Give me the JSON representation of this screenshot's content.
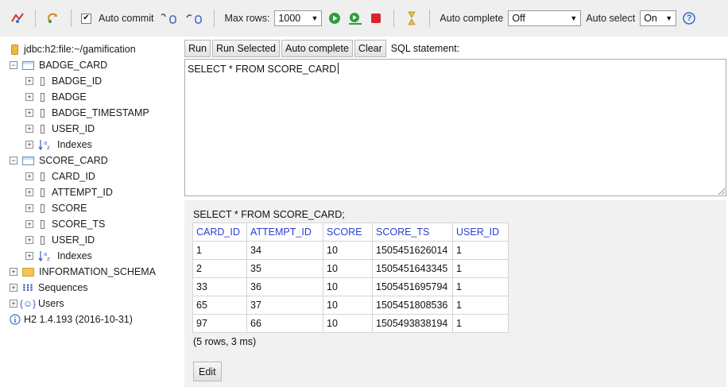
{
  "toolbar": {
    "auto_commit_label": "Auto commit",
    "auto_commit_checked": true,
    "max_rows_label": "Max rows:",
    "max_rows_value": "1000",
    "auto_complete_label": "Auto complete",
    "auto_complete_value": "Off",
    "auto_select_label": "Auto select",
    "auto_select_value": "On",
    "help_glyph": "?"
  },
  "tree": {
    "connection": "jdbc:h2:file:~/gamification",
    "tables": [
      {
        "name": "BADGE_CARD",
        "columns": [
          "BADGE_ID",
          "BADGE",
          "BADGE_TIMESTAMP",
          "USER_ID"
        ],
        "indexes_label": "Indexes"
      },
      {
        "name": "SCORE_CARD",
        "columns": [
          "CARD_ID",
          "ATTEMPT_ID",
          "SCORE",
          "SCORE_TS",
          "USER_ID"
        ],
        "indexes_label": "Indexes"
      }
    ],
    "schema_label": "INFORMATION_SCHEMA",
    "sequences_label": "Sequences",
    "users_label": "Users",
    "version": "H2 1.4.193 (2016-10-31)"
  },
  "sql_buttons": {
    "run": "Run",
    "run_selected": "Run Selected",
    "auto_complete": "Auto complete",
    "clear": "Clear",
    "statement_label": "SQL statement:"
  },
  "editor": {
    "text": "SELECT * FROM SCORE_CARD"
  },
  "results": {
    "query": "SELECT * FROM SCORE_CARD;",
    "columns": [
      "CARD_ID",
      "ATTEMPT_ID",
      "SCORE",
      "SCORE_TS",
      "USER_ID"
    ],
    "rows": [
      [
        "1",
        "34",
        "10",
        "1505451626014",
        "1"
      ],
      [
        "2",
        "35",
        "10",
        "1505451643345",
        "1"
      ],
      [
        "33",
        "36",
        "10",
        "1505451695794",
        "1"
      ],
      [
        "65",
        "37",
        "10",
        "1505451808536",
        "1"
      ],
      [
        "97",
        "66",
        "10",
        "1505493838194",
        "1"
      ]
    ],
    "summary": "(5 rows, 3 ms)",
    "edit_label": "Edit"
  },
  "colors": {
    "header_text": "#2a3fd0",
    "toolbar_bg": "#efefef",
    "results_bg": "#f1f1f1",
    "run_icon": "#2e9e3a",
    "stop_icon": "#d9232d",
    "help_icon": "#2f6fd1"
  }
}
